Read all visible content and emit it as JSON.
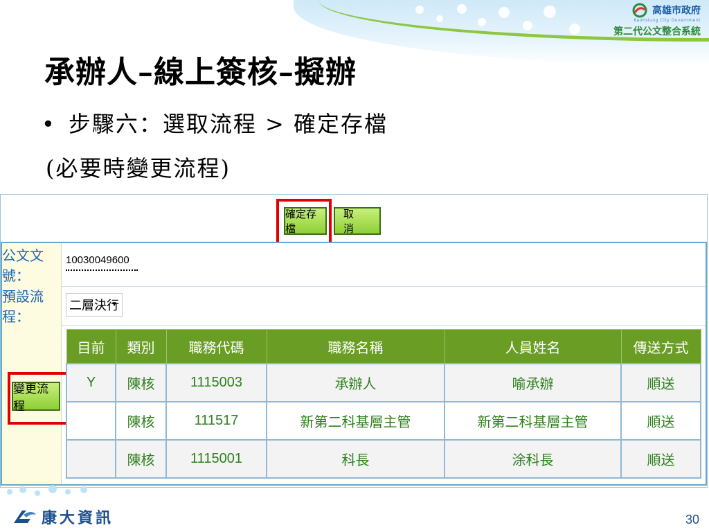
{
  "header": {
    "gov_name": "高雄市政府",
    "gov_english": "Kaohsiung City Government",
    "system_name": "第二代公文整合系統"
  },
  "slide": {
    "title": "承辦人–線上簽核–擬辦",
    "bullet": "步驟六：選取流程 > 確定存檔",
    "sub": "(必要時變更流程)"
  },
  "toolbar": {
    "save_label": "確定存檔",
    "cancel_label": "取消"
  },
  "form": {
    "doc_label": "公文文號：",
    "doc_number": "10030049600",
    "flow_label": "預設流程：",
    "flow_selected": "二層決行",
    "change_flow_label": "變更流程"
  },
  "flow_table": {
    "headers": [
      "目前",
      "類別",
      "職務代碼",
      "職務名稱",
      "人員姓名",
      "傳送方式"
    ],
    "rows": [
      [
        "Y",
        "陳核",
        "1115003",
        "承辦人",
        "喻承辦",
        "順送"
      ],
      [
        "",
        "陳核",
        "111517",
        "新第二科基層主管",
        "新第二科基層主管",
        "順送"
      ],
      [
        "",
        "陳核",
        "1115001",
        "科長",
        "涂科長",
        "順送"
      ]
    ]
  },
  "footer": {
    "company": "康大資訊",
    "page_number": "30"
  },
  "colors": {
    "accent_green": "#6a9d24",
    "highlight_red": "#e00000",
    "label_blue": "#1f66b3"
  }
}
